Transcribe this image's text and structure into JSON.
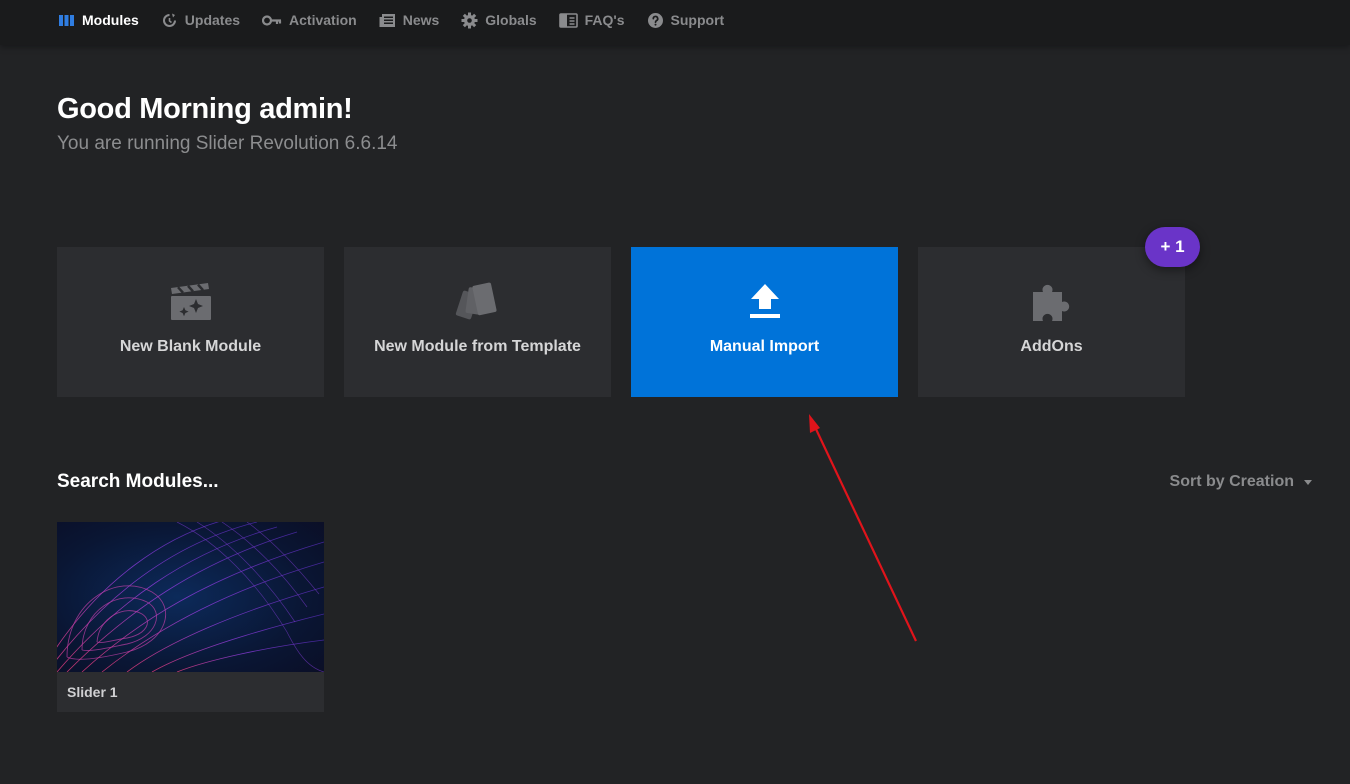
{
  "nav": {
    "items": [
      {
        "label": "Modules",
        "icon": "modules-icon",
        "active": true
      },
      {
        "label": "Updates",
        "icon": "updates-icon"
      },
      {
        "label": "Activation",
        "icon": "key-icon"
      },
      {
        "label": "News",
        "icon": "news-icon"
      },
      {
        "label": "Globals",
        "icon": "gear-icon"
      },
      {
        "label": "FAQ's",
        "icon": "faq-icon"
      },
      {
        "label": "Support",
        "icon": "support-icon"
      }
    ]
  },
  "header": {
    "greeting": "Good Morning admin!",
    "subtitle": "You are running Slider Revolution 6.6.14"
  },
  "actions": [
    {
      "label": "New Blank Module",
      "icon": "clapperboard-sparkle-icon"
    },
    {
      "label": "New Module from Template",
      "icon": "template-cards-icon"
    },
    {
      "label": "Manual Import",
      "icon": "upload-icon"
    },
    {
      "label": "AddOns",
      "icon": "puzzle-icon"
    }
  ],
  "addons_badge": "+ 1",
  "modules": {
    "search_title": "Search Modules...",
    "sort_label": "Sort by Creation",
    "items": [
      {
        "name": "Slider 1"
      }
    ]
  },
  "colors": {
    "background": "#222325",
    "topbar": "#1a1b1c",
    "card": "#2c2d30",
    "accent": "#0073d9",
    "badge": "#6a34c8",
    "annotation_arrow": "#e0141b"
  }
}
